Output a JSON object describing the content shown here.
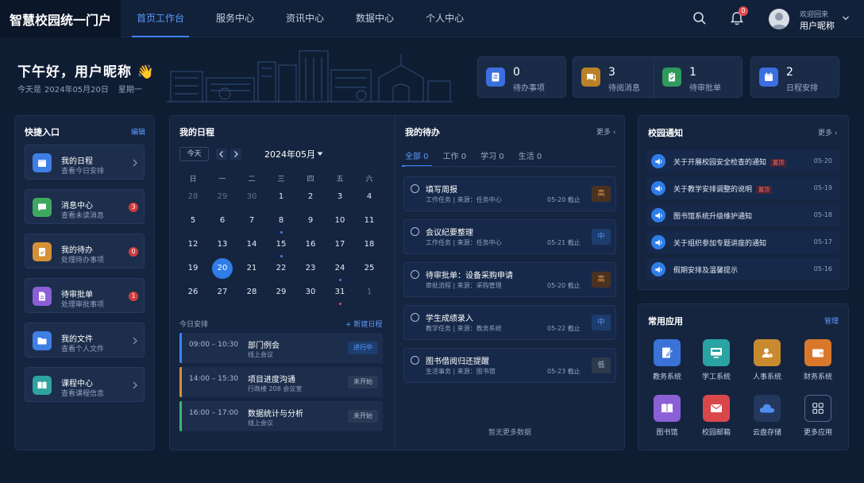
{
  "nav": {
    "brand": "智慧校园统一门户",
    "menu": [
      "首页工作台",
      "服务中心",
      "资讯中心",
      "数据中心",
      "个人中心"
    ],
    "bell_count": "0",
    "user_greeting": "欢迎回来",
    "user_name": "用户昵称"
  },
  "hero": {
    "greeting": "下午好，用户昵称 👋",
    "date_prefix": "今天是",
    "date": "2024年05月20日",
    "weekday": "星期一"
  },
  "stats": [
    {
      "value": "0",
      "label": "待办事项",
      "icon": "document-icon",
      "color": "#3b6ee0"
    },
    {
      "value": "3",
      "label": "待阅消息",
      "icon": "chat-icon",
      "color": "#e0a23b"
    },
    {
      "value": "1",
      "label": "待审批单",
      "icon": "clipboard-check-icon",
      "color": "#3bb46e"
    },
    {
      "value": "2",
      "label": "日程安排",
      "icon": "calendar-icon",
      "color": "#3b6ee0"
    }
  ],
  "quick": {
    "title": "快捷入口",
    "edit": "编辑",
    "items": [
      {
        "title": "我的日程",
        "sub": "查看今日安排",
        "badge": "",
        "icon": "calendar-icon",
        "color": "#3e7fe6"
      },
      {
        "title": "消息中心",
        "sub": "查看未读消息",
        "badge": "3",
        "icon": "message-icon",
        "color": "#3fa85f"
      },
      {
        "title": "我的待办",
        "sub": "处理待办事项",
        "badge": "0",
        "icon": "clipboard-icon",
        "color": "#d69036"
      },
      {
        "title": "待审批单",
        "sub": "处理审批事项",
        "badge": "1",
        "icon": "document-icon",
        "color": "#8b5fd6"
      },
      {
        "title": "我的文件",
        "sub": "查看个人文件",
        "badge": "",
        "icon": "folder-icon",
        "color": "#3e7fe6"
      },
      {
        "title": "课程中心",
        "sub": "查看课程信息",
        "badge": "",
        "icon": "book-icon",
        "color": "#2fa3a0"
      }
    ]
  },
  "calendar": {
    "title": "我的日程",
    "today_btn": "今天",
    "month": "2024年05月",
    "weekdays": [
      "日",
      "一",
      "二",
      "三",
      "四",
      "五",
      "六"
    ],
    "days": [
      "28",
      "29",
      "30",
      "1",
      "2",
      "3",
      "4",
      "5",
      "6",
      "7",
      "8",
      "9",
      "10",
      "11",
      "12",
      "13",
      "14",
      "15",
      "16",
      "17",
      "18",
      "19",
      "20",
      "21",
      "22",
      "23",
      "24",
      "25",
      "26",
      "27",
      "28",
      "29",
      "30",
      "31",
      "1"
    ],
    "muted": [
      0,
      1,
      2,
      34
    ],
    "selected": 22,
    "blue_dots": [
      10,
      17,
      26
    ],
    "red_dots": [
      33
    ],
    "schedule_header": "今日安排",
    "new_label": "+ 新建日程",
    "schedule": [
      {
        "time": "09:00 – 10:30",
        "title": "部门例会",
        "location": "线上会议",
        "status": "进行中",
        "color": "#3d82f5"
      },
      {
        "time": "14:00 – 15:30",
        "title": "项目进度沟通",
        "location": "行政楼 208 会议室",
        "status": "未开始",
        "color": "#d69036"
      },
      {
        "time": "16:00 – 17:00",
        "title": "数据统计与分析",
        "location": "线上会议",
        "status": "未开始",
        "color": "#3bb46e"
      }
    ]
  },
  "todo": {
    "title": "我的待办",
    "more": "更多",
    "tabs": [
      "全部  0",
      "工作 0",
      "学习 0",
      "生活 0"
    ],
    "items": [
      {
        "title": "填写周报",
        "meta": "工作任务  |  来源：任务中心",
        "due": "05-20 截止",
        "priority": "高",
        "level": "high"
      },
      {
        "title": "会议纪要整理",
        "meta": "工作任务  |  来源：任务中心",
        "due": "05-21 截止",
        "priority": "中",
        "level": "mid"
      },
      {
        "title": "待审批单：设备采购申请",
        "meta": "审批流程  |  来源：采购管理",
        "due": "05-20 截止",
        "priority": "高",
        "level": "high"
      },
      {
        "title": "学生成绩录入",
        "meta": "教学任务  |  来源：教务系统",
        "due": "05-22 截止",
        "priority": "中",
        "level": "mid"
      },
      {
        "title": "图书借阅归还提醒",
        "meta": "生活事务  |  来源：图书馆",
        "due": "05-23 截止",
        "priority": "低",
        "level": "low"
      }
    ],
    "empty": "暂无更多数据"
  },
  "notices": {
    "title": "校园通知",
    "more": "更多",
    "items": [
      {
        "title": "关于开展校园安全检查的通知",
        "tag": "置顶",
        "date": "05-20"
      },
      {
        "title": "关于教学安排调整的说明",
        "tag": "置顶",
        "date": "05-19"
      },
      {
        "title": "图书馆系统升级维护通知",
        "tag": "",
        "date": "05-18"
      },
      {
        "title": "关于组织参加专题讲座的通知",
        "tag": "",
        "date": "05-17"
      },
      {
        "title": "假期安排及温馨提示",
        "tag": "",
        "date": "05-16"
      }
    ]
  },
  "apps": {
    "title": "常用应用",
    "manage": "管理",
    "items": [
      {
        "label": "教务系统",
        "icon": "edit-doc-icon",
        "color": "#3a72d8"
      },
      {
        "label": "学工系统",
        "icon": "monitor-icon",
        "color": "#2aa3a3"
      },
      {
        "label": "人事系统",
        "icon": "person-card-icon",
        "color": "#c88a2e"
      },
      {
        "label": "财务系统",
        "icon": "wallet-icon",
        "color": "#d9782b"
      },
      {
        "label": "图书馆",
        "icon": "book-icon",
        "color": "#8b5fd6"
      },
      {
        "label": "校园邮箱",
        "icon": "mail-icon",
        "color": "#d9474a"
      },
      {
        "label": "云盘存储",
        "icon": "cloud-icon",
        "color": "#3a72d8"
      },
      {
        "label": "更多应用",
        "icon": "grid-icon",
        "color": ""
      }
    ]
  }
}
